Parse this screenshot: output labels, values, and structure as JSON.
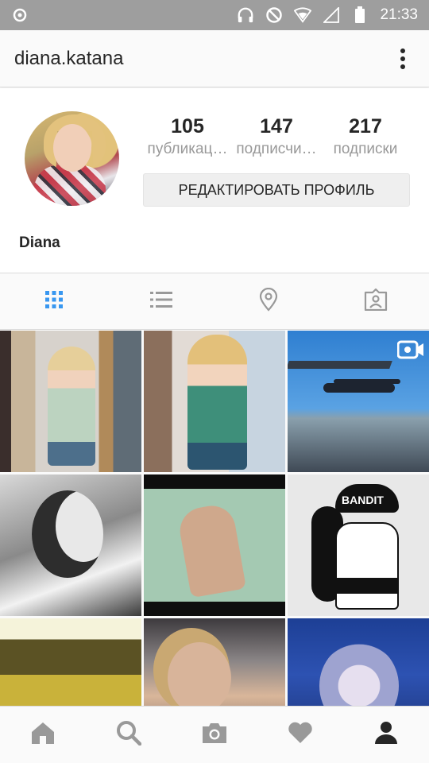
{
  "status_bar": {
    "time": "21:33",
    "icons": [
      "notification-icon",
      "headphones-icon",
      "do-not-disturb-icon",
      "wifi-icon",
      "signal-icon",
      "battery-icon"
    ]
  },
  "header": {
    "username": "diana.katana",
    "more_icon": "more-vertical-icon"
  },
  "profile": {
    "stats": [
      {
        "count": "105",
        "label": "публикац…"
      },
      {
        "count": "147",
        "label": "подписчи…"
      },
      {
        "count": "217",
        "label": "подписки"
      }
    ],
    "edit_button": "РЕДАКТИРОВАТЬ ПРОФИЛЬ",
    "display_name": "Diana"
  },
  "tabs": [
    {
      "icon": "grid-icon",
      "active": true
    },
    {
      "icon": "list-icon",
      "active": false
    },
    {
      "icon": "location-pin-icon",
      "active": false
    },
    {
      "icon": "tagged-photos-icon",
      "active": false
    }
  ],
  "grid": {
    "posts": [
      {
        "type": "photo"
      },
      {
        "type": "photo"
      },
      {
        "type": "video"
      },
      {
        "type": "photo"
      },
      {
        "type": "photo"
      },
      {
        "type": "photo",
        "text": "BANDIT"
      },
      {
        "type": "photo"
      },
      {
        "type": "photo"
      },
      {
        "type": "photo"
      }
    ]
  },
  "bottom_nav": [
    {
      "icon": "home-icon"
    },
    {
      "icon": "search-icon"
    },
    {
      "icon": "camera-icon"
    },
    {
      "icon": "heart-icon"
    },
    {
      "icon": "profile-icon",
      "active": true
    }
  ],
  "colors": {
    "accent": "#3897f0",
    "inactive_icon": "#999999",
    "status_bar": "#9e9e9e"
  }
}
